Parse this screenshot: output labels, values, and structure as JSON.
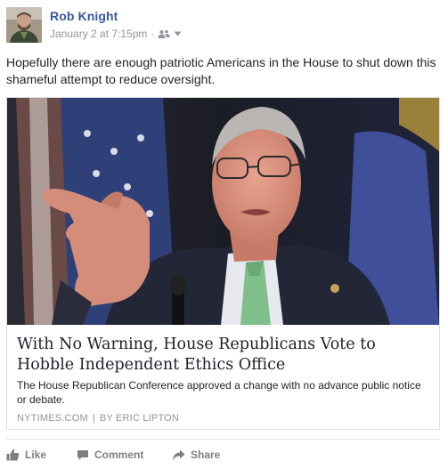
{
  "post": {
    "author": "Rob Knight",
    "timestamp": "January 2 at 7:15pm",
    "separator": "·",
    "audience_icon": "friends-icon",
    "text": "Hopefully there are enough patriotic Americans in the House to shut down this shameful attempt to reduce oversight."
  },
  "link_card": {
    "image_icon": "article-photo",
    "title": "With No Warning, House Republicans Vote to Hobble Independent Ethics Office",
    "description": "The House Republican Conference approved a change with no advance public notice or debate.",
    "source": "NYTIMES.COM",
    "source_separator": "|",
    "byline": "BY ERIC LIPTON"
  },
  "actions": {
    "like": "Like",
    "comment": "Comment",
    "share": "Share"
  },
  "colors": {
    "author_link": "#365899",
    "meta_gray": "#90949c",
    "action_gray": "#7f7f7f",
    "border": "#dddfe2"
  }
}
